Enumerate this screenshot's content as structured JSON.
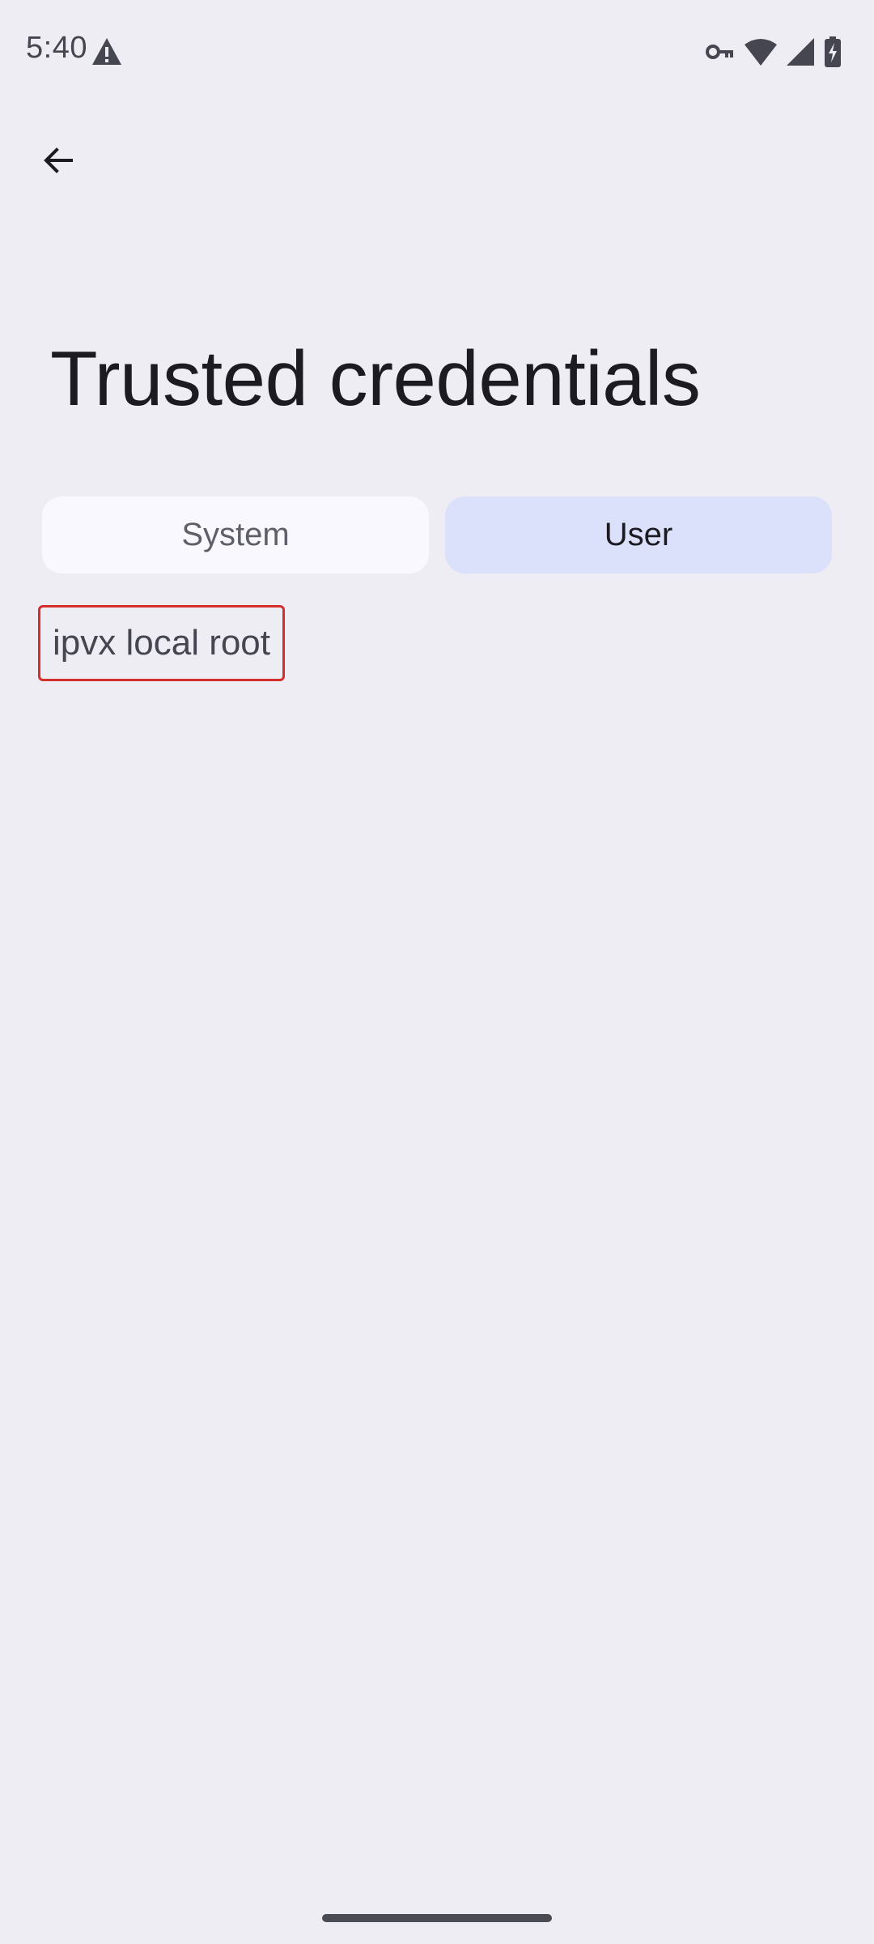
{
  "status_bar": {
    "time": "5:40",
    "icons": [
      "alert-triangle-icon",
      "vpn-key-icon",
      "wifi-icon",
      "cellular-signal-icon",
      "battery-charging-icon"
    ]
  },
  "header": {
    "back_icon": "arrow-back-icon",
    "title": "Trusted credentials"
  },
  "tabs": [
    {
      "label": "System",
      "selected": false
    },
    {
      "label": "User",
      "selected": true
    }
  ],
  "credentials": [
    {
      "name": "ipvx local root"
    }
  ],
  "colors": {
    "background": "#EEEDF4",
    "tab_selected": "#DCE1FB",
    "tab_unselected": "#F8F8FE",
    "highlight_border": "#D32F2F"
  }
}
